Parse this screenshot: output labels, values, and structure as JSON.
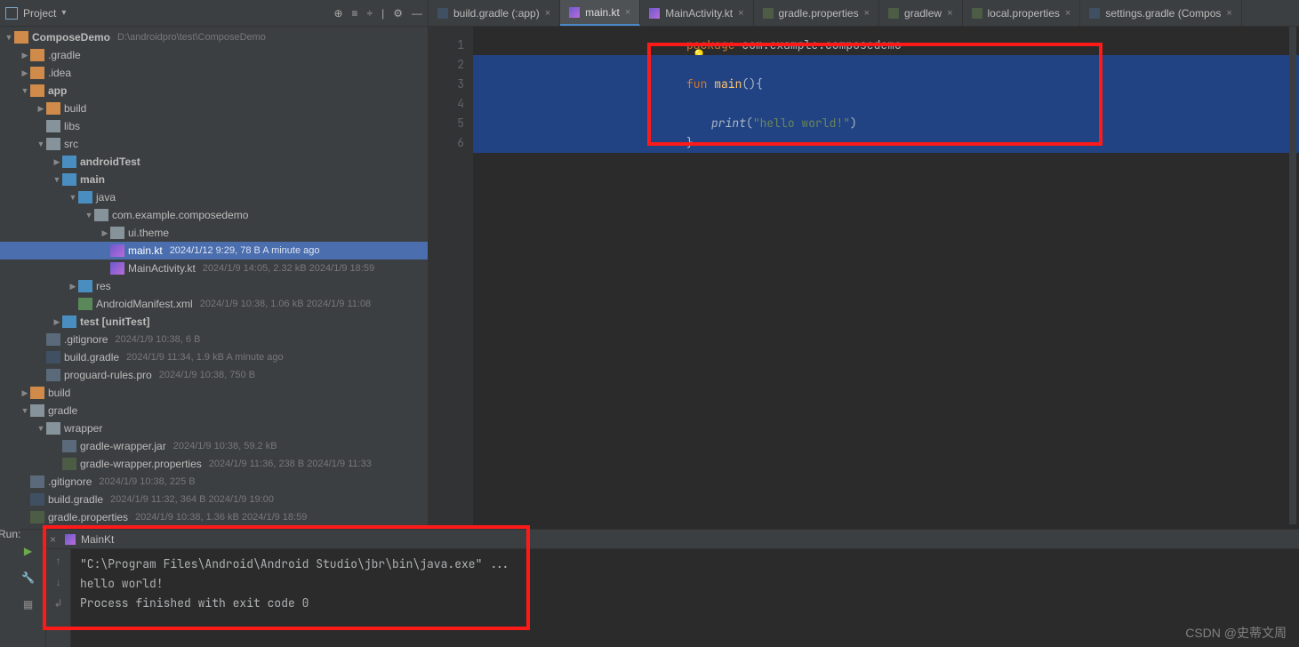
{
  "sidebar": {
    "title": "Project",
    "tools": [
      "⊕",
      "≡",
      "÷",
      "⚙",
      "—"
    ]
  },
  "tree": {
    "root": {
      "name": "ComposeDemo",
      "path": "D:\\androidpro\\test\\ComposeDemo"
    },
    "items": [
      {
        "indent": 1,
        "arrow": "closed",
        "icon": "folder-mod",
        "name": ".gradle"
      },
      {
        "indent": 1,
        "arrow": "closed",
        "icon": "folder-mod",
        "name": ".idea"
      },
      {
        "indent": 1,
        "arrow": "open",
        "icon": "folder-mod",
        "name": "app",
        "bold": true
      },
      {
        "indent": 2,
        "arrow": "closed",
        "icon": "folder-mod",
        "name": "build"
      },
      {
        "indent": 2,
        "arrow": "",
        "icon": "folder-dir",
        "name": "libs"
      },
      {
        "indent": 2,
        "arrow": "open",
        "icon": "folder-dir",
        "name": "src"
      },
      {
        "indent": 3,
        "arrow": "closed",
        "icon": "folder-src",
        "name": "androidTest",
        "bold": true
      },
      {
        "indent": 3,
        "arrow": "open",
        "icon": "folder-src",
        "name": "main",
        "bold": true
      },
      {
        "indent": 4,
        "arrow": "open",
        "icon": "folder-src",
        "name": "java"
      },
      {
        "indent": 5,
        "arrow": "open",
        "icon": "folder-dir",
        "name": "com.example.composedemo"
      },
      {
        "indent": 6,
        "arrow": "closed",
        "icon": "folder-dir",
        "name": "ui.theme"
      },
      {
        "indent": 6,
        "arrow": "",
        "icon": "file-kt",
        "name": "main.kt",
        "meta": "2024/1/12 9:29, 78 B  A minute ago",
        "selected": true
      },
      {
        "indent": 6,
        "arrow": "",
        "icon": "file-kt",
        "name": "MainActivity.kt",
        "meta": "2024/1/9 14:05, 2.32 kB  2024/1/9 18:59"
      },
      {
        "indent": 4,
        "arrow": "closed",
        "icon": "folder-src",
        "name": "res"
      },
      {
        "indent": 4,
        "arrow": "",
        "icon": "file-xml",
        "name": "AndroidManifest.xml",
        "meta": "2024/1/9 10:38, 1.06 kB  2024/1/9 11:08"
      },
      {
        "indent": 3,
        "arrow": "closed",
        "icon": "folder-src",
        "name": "test [unitTest]",
        "bold": true
      },
      {
        "indent": 2,
        "arrow": "",
        "icon": "file-txt",
        "name": ".gitignore",
        "meta": "2024/1/9 10:38, 6 B"
      },
      {
        "indent": 2,
        "arrow": "",
        "icon": "file-elephant",
        "name": "build.gradle",
        "meta": "2024/1/9 11:34, 1.9 kB  A minute ago"
      },
      {
        "indent": 2,
        "arrow": "",
        "icon": "file-txt",
        "name": "proguard-rules.pro",
        "meta": "2024/1/9 10:38, 750 B"
      },
      {
        "indent": 1,
        "arrow": "closed",
        "icon": "folder-mod",
        "name": "build"
      },
      {
        "indent": 1,
        "arrow": "open",
        "icon": "folder-dir",
        "name": "gradle"
      },
      {
        "indent": 2,
        "arrow": "open",
        "icon": "folder-dir",
        "name": "wrapper"
      },
      {
        "indent": 3,
        "arrow": "",
        "icon": "file-jar",
        "name": "gradle-wrapper.jar",
        "meta": "2024/1/9 10:38, 59.2 kB"
      },
      {
        "indent": 3,
        "arrow": "",
        "icon": "file-props",
        "name": "gradle-wrapper.properties",
        "meta": "2024/1/9 11:36, 238 B  2024/1/9 11:33"
      },
      {
        "indent": 1,
        "arrow": "",
        "icon": "file-txt",
        "name": ".gitignore",
        "meta": "2024/1/9 10:38, 225 B"
      },
      {
        "indent": 1,
        "arrow": "",
        "icon": "file-elephant",
        "name": "build.gradle",
        "meta": "2024/1/9 11:32, 364 B  2024/1/9 19:00"
      },
      {
        "indent": 1,
        "arrow": "",
        "icon": "file-props",
        "name": "gradle.properties",
        "meta": "2024/1/9 10:38, 1.36 kB  2024/1/9 18:59"
      }
    ]
  },
  "tabs": [
    {
      "icon": "file-elephant",
      "label": "build.gradle (:app)"
    },
    {
      "icon": "file-kt",
      "label": "main.kt",
      "active": true
    },
    {
      "icon": "file-kt",
      "label": "MainActivity.kt"
    },
    {
      "icon": "file-props",
      "label": "gradle.properties"
    },
    {
      "icon": "file-props",
      "label": "gradlew"
    },
    {
      "icon": "file-props",
      "label": "local.properties"
    },
    {
      "icon": "file-elephant",
      "label": "settings.gradle (Compos"
    }
  ],
  "code": {
    "lines": [
      "1",
      "2",
      "3",
      "4",
      "5",
      "6"
    ],
    "l1_kw": "package",
    "l1_pkg": " com.example.composedemo",
    "l3_kw": "fun",
    "l3_name": " main",
    "l3_tail": "(){",
    "l5_call": "print",
    "l5_p1": "(",
    "l5_str": "\"hello world!\"",
    "l5_p2": ")",
    "l6_brace": "}"
  },
  "run": {
    "label": "Run:",
    "tab": "MainKt",
    "lines": [
      "\"C:\\Program Files\\Android\\Android Studio\\jbr\\bin\\java.exe\" ...",
      "hello world!",
      "Process finished with exit code 0"
    ]
  },
  "watermark": "CSDN @史蒂文周"
}
